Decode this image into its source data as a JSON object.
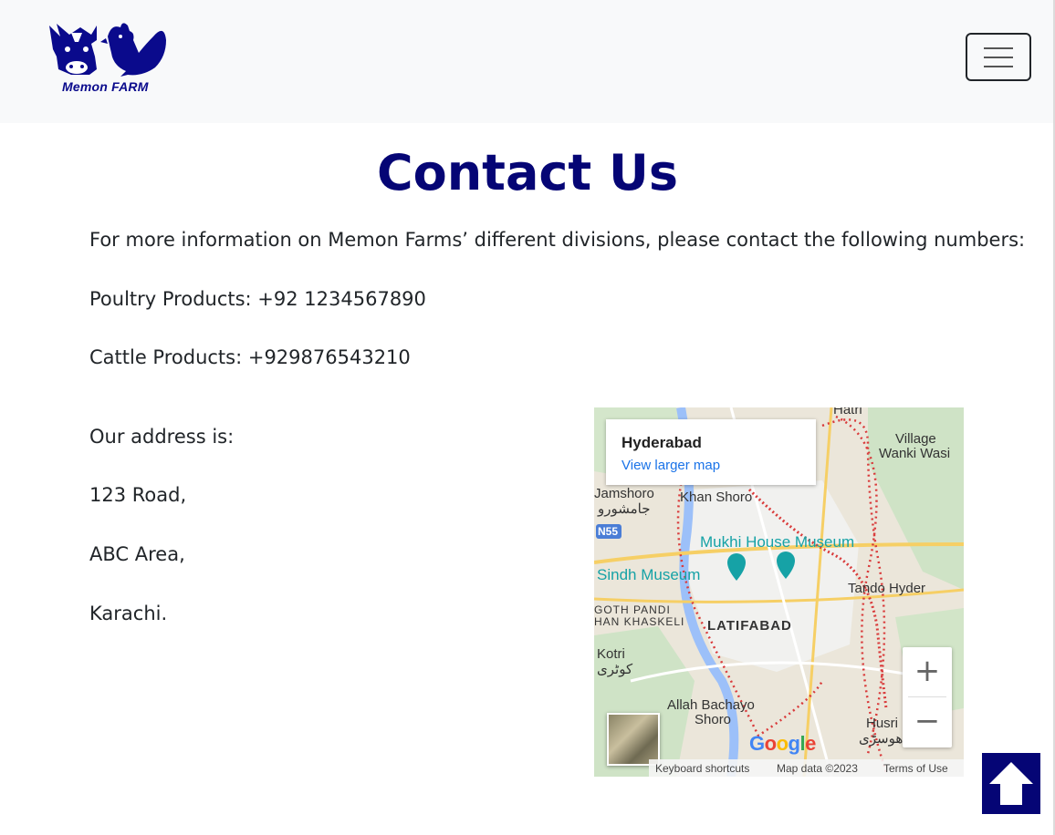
{
  "brand": {
    "logo_text": "Memon FARM"
  },
  "nav": {
    "toggler_icon": "hamburger-icon"
  },
  "page": {
    "title": "Contact Us",
    "intro": "For more information on Memon Farms’ different divisions, please contact the following numbers:",
    "poultry": "Poultry Products: +92 1234567890",
    "cattle": "Cattle Products: +929876543210",
    "address_heading": "Our address is:",
    "address_lines": [
      "123 Road,",
      "ABC Area,",
      "Karachi."
    ]
  },
  "map": {
    "place_name": "Hyderabad",
    "view_larger": "View larger map",
    "labels": {
      "hatri": "Hatri",
      "village": "Village",
      "wanki_wasi": "Wanki Wasi",
      "jamshoro": "Jamshoro",
      "jamshoro_urdu": "جامشورو",
      "khan_shoro": "Khan Shoro",
      "n55": "N55",
      "mukhi": "Mukhi House Museum",
      "sindh": "Sindh Museum",
      "tando_hyder": "Tando Hyder",
      "goth_pandi": "GOTH PANDI",
      "han_khaskeli": "HAN KHASKELI",
      "latifabad": "LATIFABAD",
      "kotri": "Kotri",
      "kotri_urdu": "کوٹری",
      "allah_bachayo": "Allah Bachayo",
      "shoro": "Shoro",
      "husri": "Husri",
      "husri_urdu": "ھوسڑی"
    },
    "zoom_in": "+",
    "zoom_out": "−",
    "google": "Google",
    "keyboard_shortcuts": "Keyboard shortcuts",
    "map_data": "Map data ©2023",
    "terms": "Terms of Use"
  },
  "scroll_top_icon": "arrow-up-icon"
}
